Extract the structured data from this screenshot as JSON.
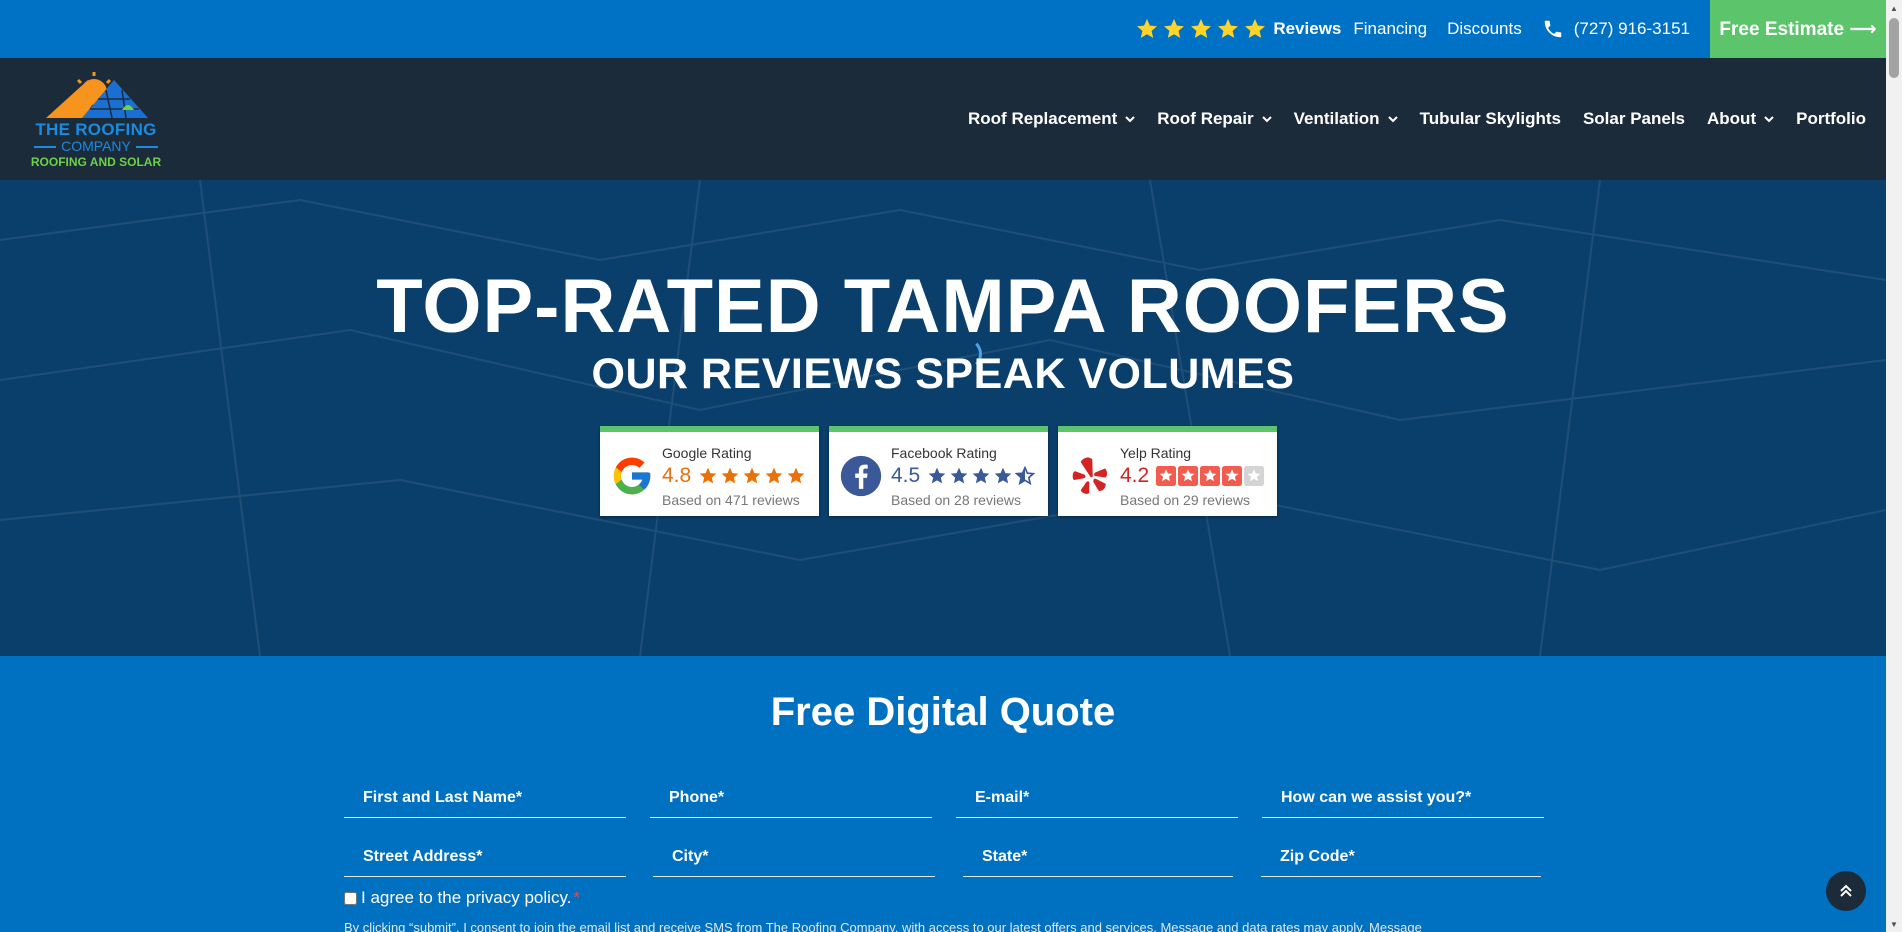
{
  "topbar": {
    "reviews_label": "Reviews",
    "financing_label": "Financing",
    "discounts_label": "Discounts",
    "phone": "(727) 916-3151",
    "estimate_label": "Free Estimate ⟶"
  },
  "logo": {
    "line1": "THE ROOFING",
    "line2": "COMPANY",
    "line3": "ROOFING AND SOLAR"
  },
  "nav": {
    "items": [
      {
        "label": "Roof Replacement",
        "dropdown": true
      },
      {
        "label": "Roof Repair",
        "dropdown": true
      },
      {
        "label": "Ventilation",
        "dropdown": true
      },
      {
        "label": "Tubular Skylights",
        "dropdown": false
      },
      {
        "label": "Solar Panels",
        "dropdown": false
      },
      {
        "label": "About",
        "dropdown": true
      },
      {
        "label": "Portfolio",
        "dropdown": false
      }
    ]
  },
  "hero": {
    "title": "TOP-RATED TAMPA ROOFERS",
    "subtitle": "OUR REVIEWS SPEAK VOLUMES",
    "ratings": [
      {
        "name": "Google Rating",
        "score": "4.8",
        "stars": 4.8,
        "based": "Based on 471 reviews",
        "color": "#e8710a",
        "icon": "google-icon"
      },
      {
        "name": "Facebook Rating",
        "score": "4.5",
        "stars": 4.5,
        "based": "Based on 28 reviews",
        "color": "#3b5998",
        "icon": "facebook-icon"
      },
      {
        "name": "Yelp Rating",
        "score": "4.2",
        "stars": 4.2,
        "based": "Based on 29 reviews",
        "color": "#d32323",
        "icon": "yelp-icon"
      }
    ]
  },
  "quote": {
    "title": "Free Digital Quote",
    "fields_row1": [
      "First and Last Name*",
      "Phone*",
      "E-mail*",
      "How can we assist you?*"
    ],
    "fields_row2": [
      "Street Address*",
      "City*",
      "State*",
      "Zip Code*"
    ],
    "agree_label": "I agree to the privacy policy.",
    "agree_required_mark": "*",
    "consent_text": "By clicking “submit”, I consent to join the email list and receive SMS from The Roofing Company, with access to our latest offers and services. Message and data rates may apply. Message"
  },
  "colors": {
    "brand_blue": "#0072c6",
    "nav_dark": "#1c2b3a",
    "accent_green": "#5cc46a",
    "star_yellow": "#ffd42a"
  }
}
